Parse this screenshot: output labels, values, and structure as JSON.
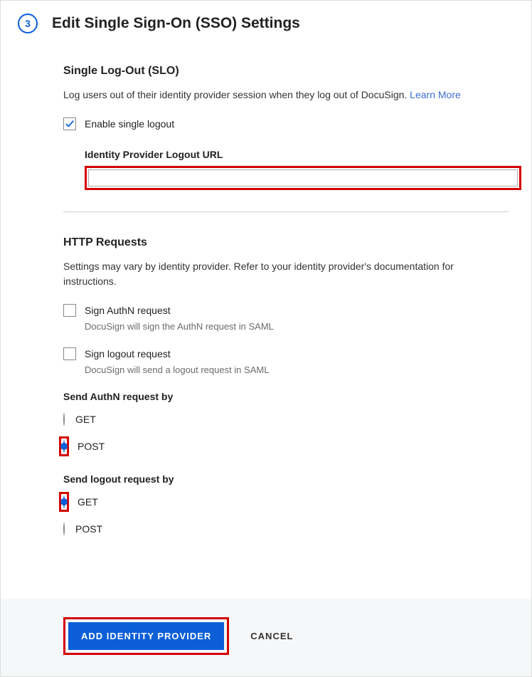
{
  "step_number": "3",
  "page_title": "Edit Single Sign-On (SSO) Settings",
  "slo": {
    "heading": "Single Log-Out (SLO)",
    "description": "Log users out of their identity provider session when they log out of DocuSign. ",
    "learn_more": "Learn More",
    "enable_label": "Enable single logout",
    "enable_checked": true,
    "logout_url_label": "Identity Provider Logout URL",
    "logout_url_value": ""
  },
  "http": {
    "heading": "HTTP Requests",
    "description": "Settings may vary by identity provider. Refer to your identity provider's documentation for instructions.",
    "sign_authn": {
      "label": "Sign AuthN request",
      "hint": "DocuSign will sign the AuthN request in SAML",
      "checked": false
    },
    "sign_logout": {
      "label": "Sign logout request",
      "hint": "DocuSign will send a logout request in SAML",
      "checked": false
    },
    "send_authn_by": {
      "title": "Send AuthN request by",
      "options": [
        "GET",
        "POST"
      ],
      "selected": "POST"
    },
    "send_logout_by": {
      "title": "Send logout request by",
      "options": [
        "GET",
        "POST"
      ],
      "selected": "GET"
    }
  },
  "footer": {
    "primary": "ADD IDENTITY PROVIDER",
    "cancel": "CANCEL"
  }
}
